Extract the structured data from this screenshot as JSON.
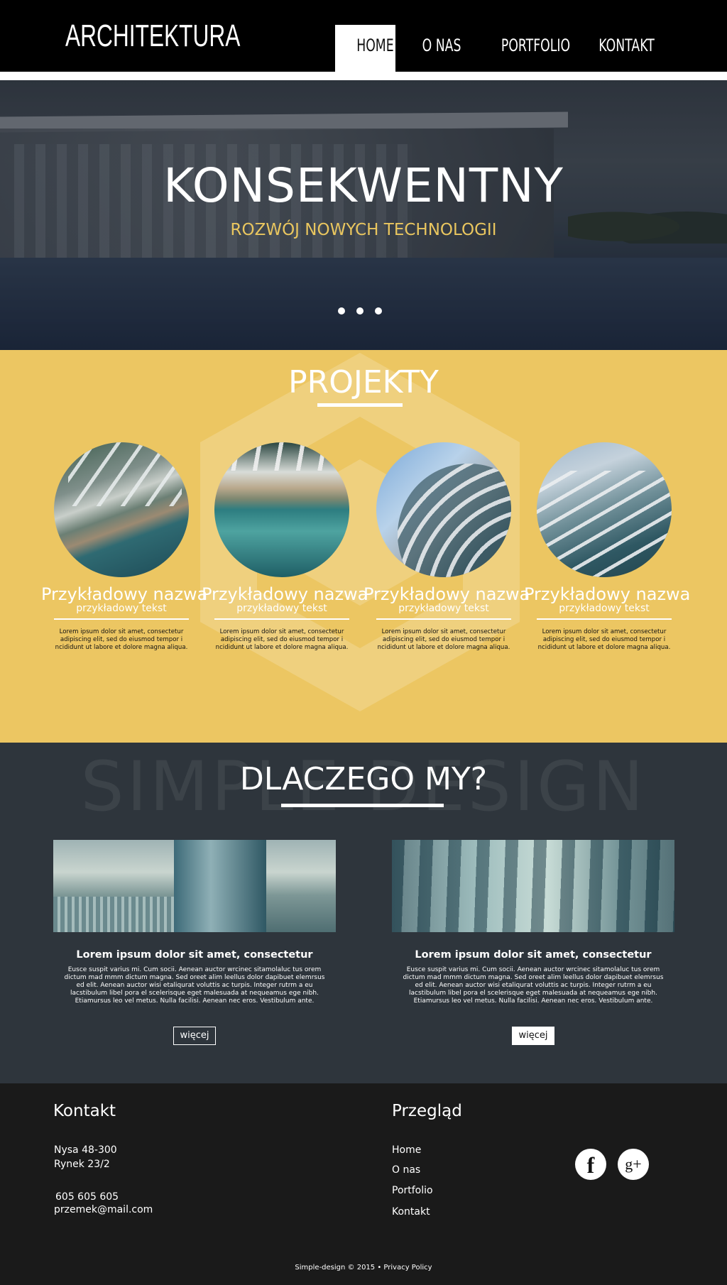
{
  "header": {
    "brand": "ARCHITEKTURA",
    "nav": [
      "HOME",
      "O NAS",
      "PORTFOLIO",
      "KONTAKT"
    ]
  },
  "hero": {
    "title": "KONSEKWENTNY",
    "subtitle": "ROZWÓJ NOWYCH TECHNOLOGII",
    "accent_color": "#e9c65f"
  },
  "projekty": {
    "title": "PROJEKTY",
    "background": "#ecc662",
    "cards": [
      {
        "name": "Przykładowy nazwa",
        "sub": "przykładowy tekst",
        "text": "Lorem ipsum dolor sit amet, consectetur adipiscing elit, sed do eiusmod tempor i ncididunt ut labore et dolore magna aliqua."
      },
      {
        "name": "Przykładowy nazwa",
        "sub": "przykładowy tekst",
        "text": "Lorem ipsum dolor sit amet, consectetur adipiscing elit, sed do eiusmod tempor i ncididunt ut labore et dolore magna aliqua."
      },
      {
        "name": "Przykładowy nazwa",
        "sub": "przykładowy tekst",
        "text": "Lorem ipsum dolor sit amet, consectetur adipiscing elit, sed do eiusmod tempor i ncididunt ut labore et dolore magna aliqua."
      },
      {
        "name": "Przykładowy nazwa",
        "sub": "przykładowy tekst",
        "text": "Lorem ipsum dolor sit amet, consectetur adipiscing elit, sed do eiusmod tempor i ncididunt ut labore et dolore magna aliqua."
      }
    ]
  },
  "dlaczego": {
    "watermark": "SIMPLE DESIGN",
    "title": "DLACZEGO MY?",
    "cards": [
      {
        "heading": "Lorem ipsum dolor sit amet, consectetur",
        "text": "Eusce suspit varius mi. Cum socii. Aenean auctor wrcinec sitamolaluc tus orem dictum mad mmm dictum magna. Sed oreet alim leellus dolor dapibuet elemrsus ed elit. Aenean auctor wisi etaliqurat voluttis ac turpis. Integer rutrm a eu lacstibulum libel pora el scelerisque eget malesuada at nequeamus ege nibh. Etiamursus leo vel metus. Nulla facilisi. Aenean nec eros. Vestibulum ante.",
        "button": "więcej"
      },
      {
        "heading": "Lorem ipsum dolor sit amet, consectetur",
        "text": "Eusce suspit varius mi. Cum socii. Aenean auctor wrcinec sitamolaluc tus orem dictum mad mmm dictum magna. Sed oreet alim leellus dolor dapibuet elemrsus ed elit. Aenean auctor wisi etaliqurat voluttis ac turpis. Integer rutrm a eu lacstibulum libel pora el scelerisque eget malesuada at nequeamus ege nibh. Etiamursus leo vel metus. Nulla facilisi. Aenean nec eros. Vestibulum ante.",
        "button": "więcej"
      }
    ]
  },
  "footer": {
    "kontakt_title": "Kontakt",
    "address1": "Nysa 48-300",
    "address2": "Rynek 23/2",
    "phone": "605 605 605",
    "email": "przemek@mail.com",
    "przeglad_title": "Przegląd",
    "links": [
      "Home",
      "O nas",
      "Portfolio",
      "Kontakt"
    ],
    "social": {
      "facebook": "f",
      "google": "g+"
    },
    "copyright": "Simple-design © 2015 • Privacy Policy"
  }
}
